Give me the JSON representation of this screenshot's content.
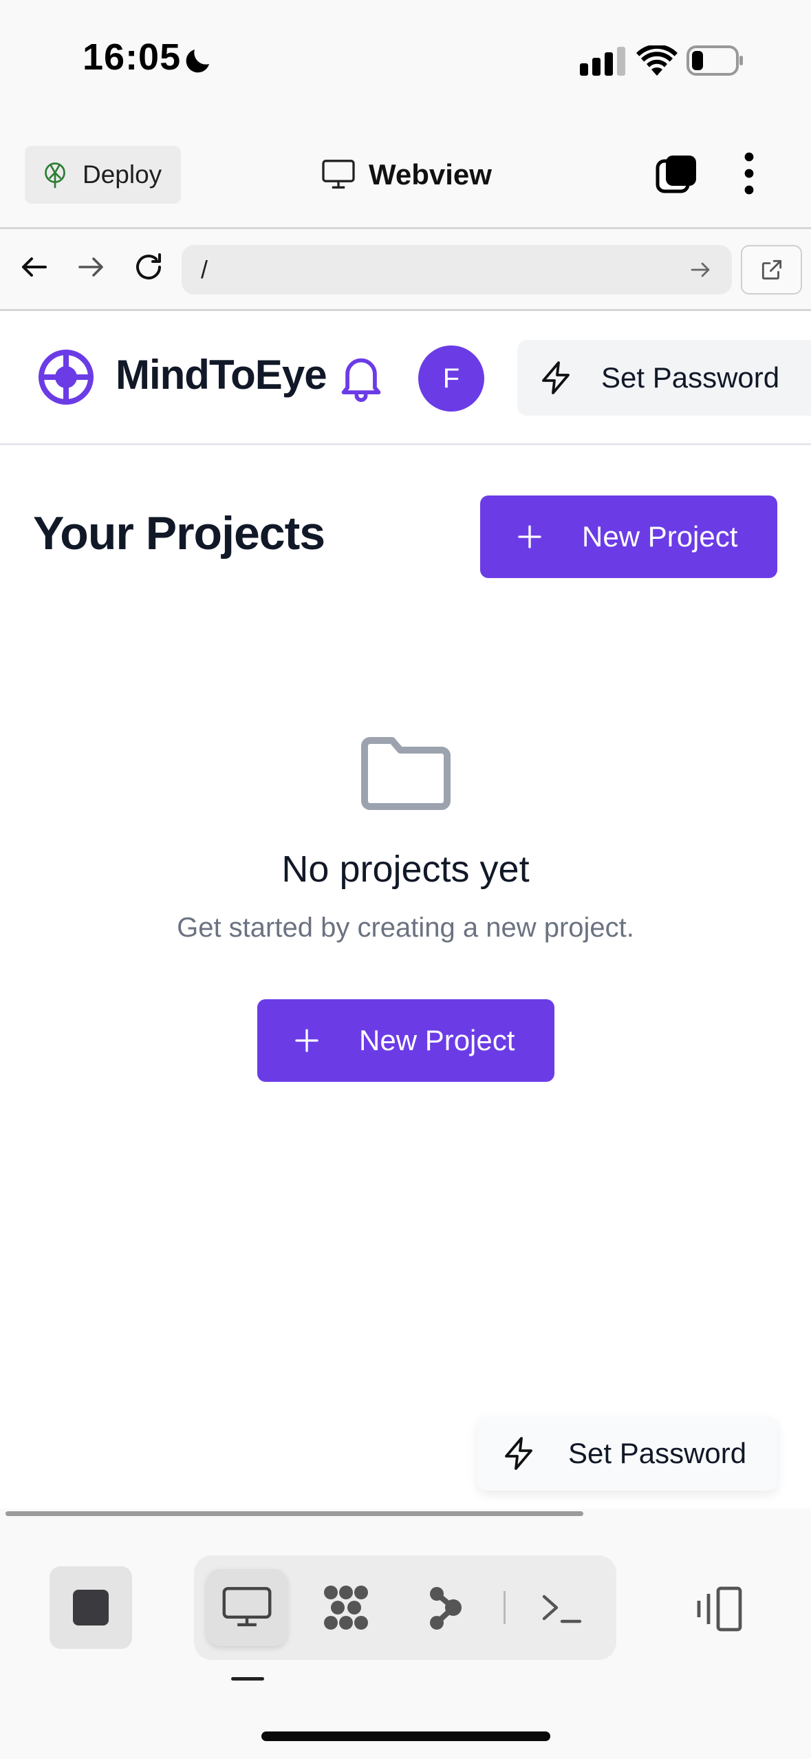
{
  "status_bar": {
    "time": "16:05"
  },
  "webview_header": {
    "deploy_label": "Deploy",
    "title": "Webview"
  },
  "url_bar": {
    "path": "/"
  },
  "app": {
    "brand": "MindToEye",
    "avatar_initial": "F",
    "set_password_label": "Set Password",
    "page_title": "Your Projects",
    "new_project_label": "New Project",
    "empty_state": {
      "title": "No projects yet",
      "subtitle": "Get started by creating a new project.",
      "button_label": "New Project"
    },
    "floating_set_password_label": "Set Password"
  },
  "colors": {
    "accent": "#6b3ce6",
    "text_primary": "#111827",
    "text_muted": "#6b7280"
  }
}
